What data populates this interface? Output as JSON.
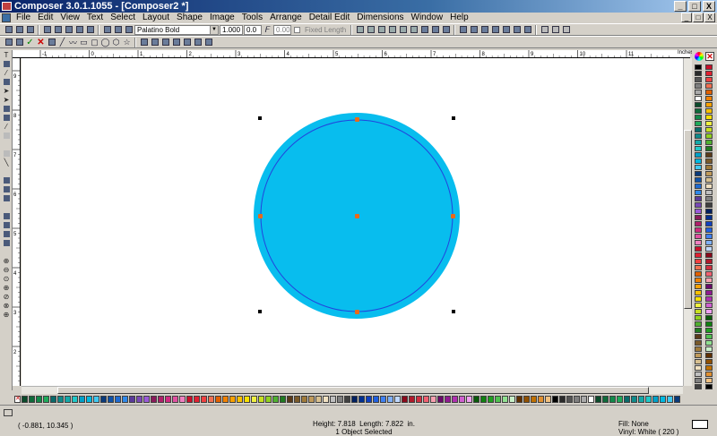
{
  "window": {
    "title": "Composer 3.0.1.1055 - [Composer2 *]",
    "min_glyph": "_",
    "max_glyph": "□",
    "close_glyph": "X"
  },
  "menu": [
    {
      "label": "File"
    },
    {
      "label": "Edit"
    },
    {
      "label": "View"
    },
    {
      "label": "Text"
    },
    {
      "label": "Select"
    },
    {
      "label": "Layout"
    },
    {
      "label": "Shape"
    },
    {
      "label": "Image"
    },
    {
      "label": "Tools"
    },
    {
      "label": "Arrange"
    },
    {
      "label": "Detail Edit"
    },
    {
      "label": "Dimensions"
    },
    {
      "label": "Window"
    },
    {
      "label": "Help"
    }
  ],
  "text_toolbar": {
    "font_name": "Palatino Bold",
    "font_size": "1.000",
    "spacing": "0.0",
    "slant": "0.00",
    "fixed_length_label": "Fixed Length"
  },
  "ruler": {
    "units_label": "Inches",
    "h_ticks": [
      "-1",
      "0",
      "1",
      "2",
      "3",
      "4",
      "5",
      "6",
      "7",
      "8",
      "9",
      "10",
      "11"
    ],
    "v_ticks": [
      "9",
      "8",
      "7",
      "6",
      "5",
      "4",
      "3",
      "2"
    ]
  },
  "shape": {
    "fill_color": "#08bdee",
    "outline_color": "#2244dd",
    "node_color": "#e86a1a"
  },
  "status": {
    "coords": "( -0.881, 10.345 )",
    "height_label": "Height: 7.818",
    "length_label": "Length: 7.822",
    "units": "in.",
    "selection": "1 Object Selected",
    "fill": "Fill: None",
    "vinyl": "Vinyl: White ( 220 )"
  },
  "palette_colors": [
    "#000000",
    "#2a2a2a",
    "#555555",
    "#7f7f7f",
    "#aaaaaa",
    "#ffffff",
    "#0b4a2a",
    "#0f6a3a",
    "#128a4a",
    "#1faa5a",
    "#0a6a6a",
    "#0f8a8a",
    "#14a8a8",
    "#1fc8c8",
    "#00a0c8",
    "#00b8e0",
    "#40c8f0",
    "#0a3a7a",
    "#0f52a8",
    "#1f6ad0",
    "#2f88e8",
    "#5a3a9a",
    "#7a4ab8",
    "#9a5ad8",
    "#8a1a5a",
    "#b0206a",
    "#d02a80",
    "#e050a0",
    "#f080c0",
    "#c8102a",
    "#e02030",
    "#f04040",
    "#f07050",
    "#e06000",
    "#f08000",
    "#f8a000",
    "#f8c000",
    "#f8e000",
    "#f0f040",
    "#c8e020",
    "#90d020",
    "#50b030",
    "#207a20",
    "#5a3a1a",
    "#7a5a2a",
    "#a07a3a",
    "#c09a5a",
    "#d8c090",
    "#f0e0c0",
    "#c0c0c0",
    "#808080",
    "#404040",
    "#002060",
    "#003090",
    "#1040c0",
    "#2060e0",
    "#4080f0",
    "#80b0f8",
    "#c0d8ff",
    "#8a0a1a",
    "#b01a2a",
    "#d03040",
    "#f06070",
    "#f8a0b0",
    "#6a0a6a",
    "#901a90",
    "#b030b0",
    "#d060d0",
    "#f0a0f0",
    "#0a5a0a",
    "#108010",
    "#20a020",
    "#50c050",
    "#90e090",
    "#c8f0c8",
    "#603000",
    "#905000",
    "#c07000",
    "#e09030",
    "#f0c080"
  ]
}
